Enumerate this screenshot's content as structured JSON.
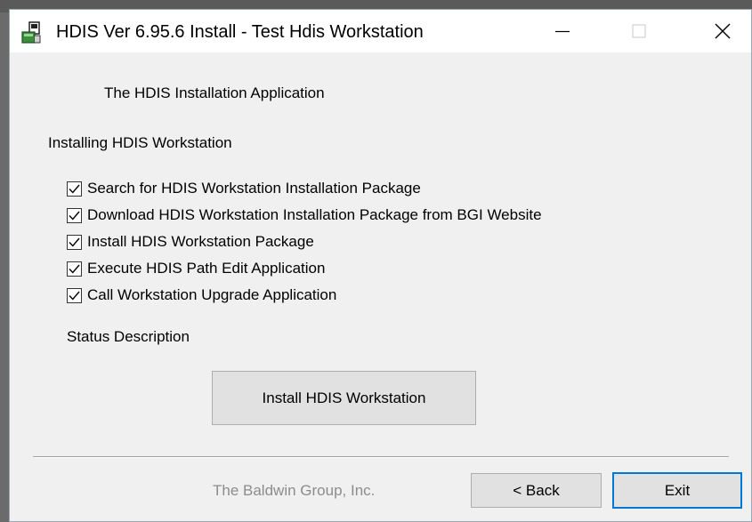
{
  "window": {
    "title": "HDIS Ver 6.95.6 Install - Test Hdis Workstation",
    "icon": "installer-icon",
    "controls": [
      "minimize-icon",
      "maximize-icon",
      "close-icon"
    ]
  },
  "main": {
    "heading": "The HDIS Installation Application",
    "section_label": "Installing HDIS Workstation",
    "steps": [
      {
        "label": "Search for HDIS Workstation Installation Package",
        "checked": true
      },
      {
        "label": "Download HDIS Workstation Installation Package from BGI Website",
        "checked": true
      },
      {
        "label": "Install HDIS Workstation Package",
        "checked": true
      },
      {
        "label": "Execute HDIS Path Edit Application",
        "checked": true
      },
      {
        "label": "Call Workstation Upgrade Application",
        "checked": true
      }
    ],
    "status_label": "Status Description",
    "install_button": "Install HDIS Workstation"
  },
  "footer": {
    "company": "The Baldwin Group, Inc.",
    "back_button": "< Back",
    "exit_button": "Exit"
  },
  "colors": {
    "window_bg": "#f0f0f0",
    "focus_border": "#0078d7",
    "disabled_text": "#8c8c8c"
  }
}
